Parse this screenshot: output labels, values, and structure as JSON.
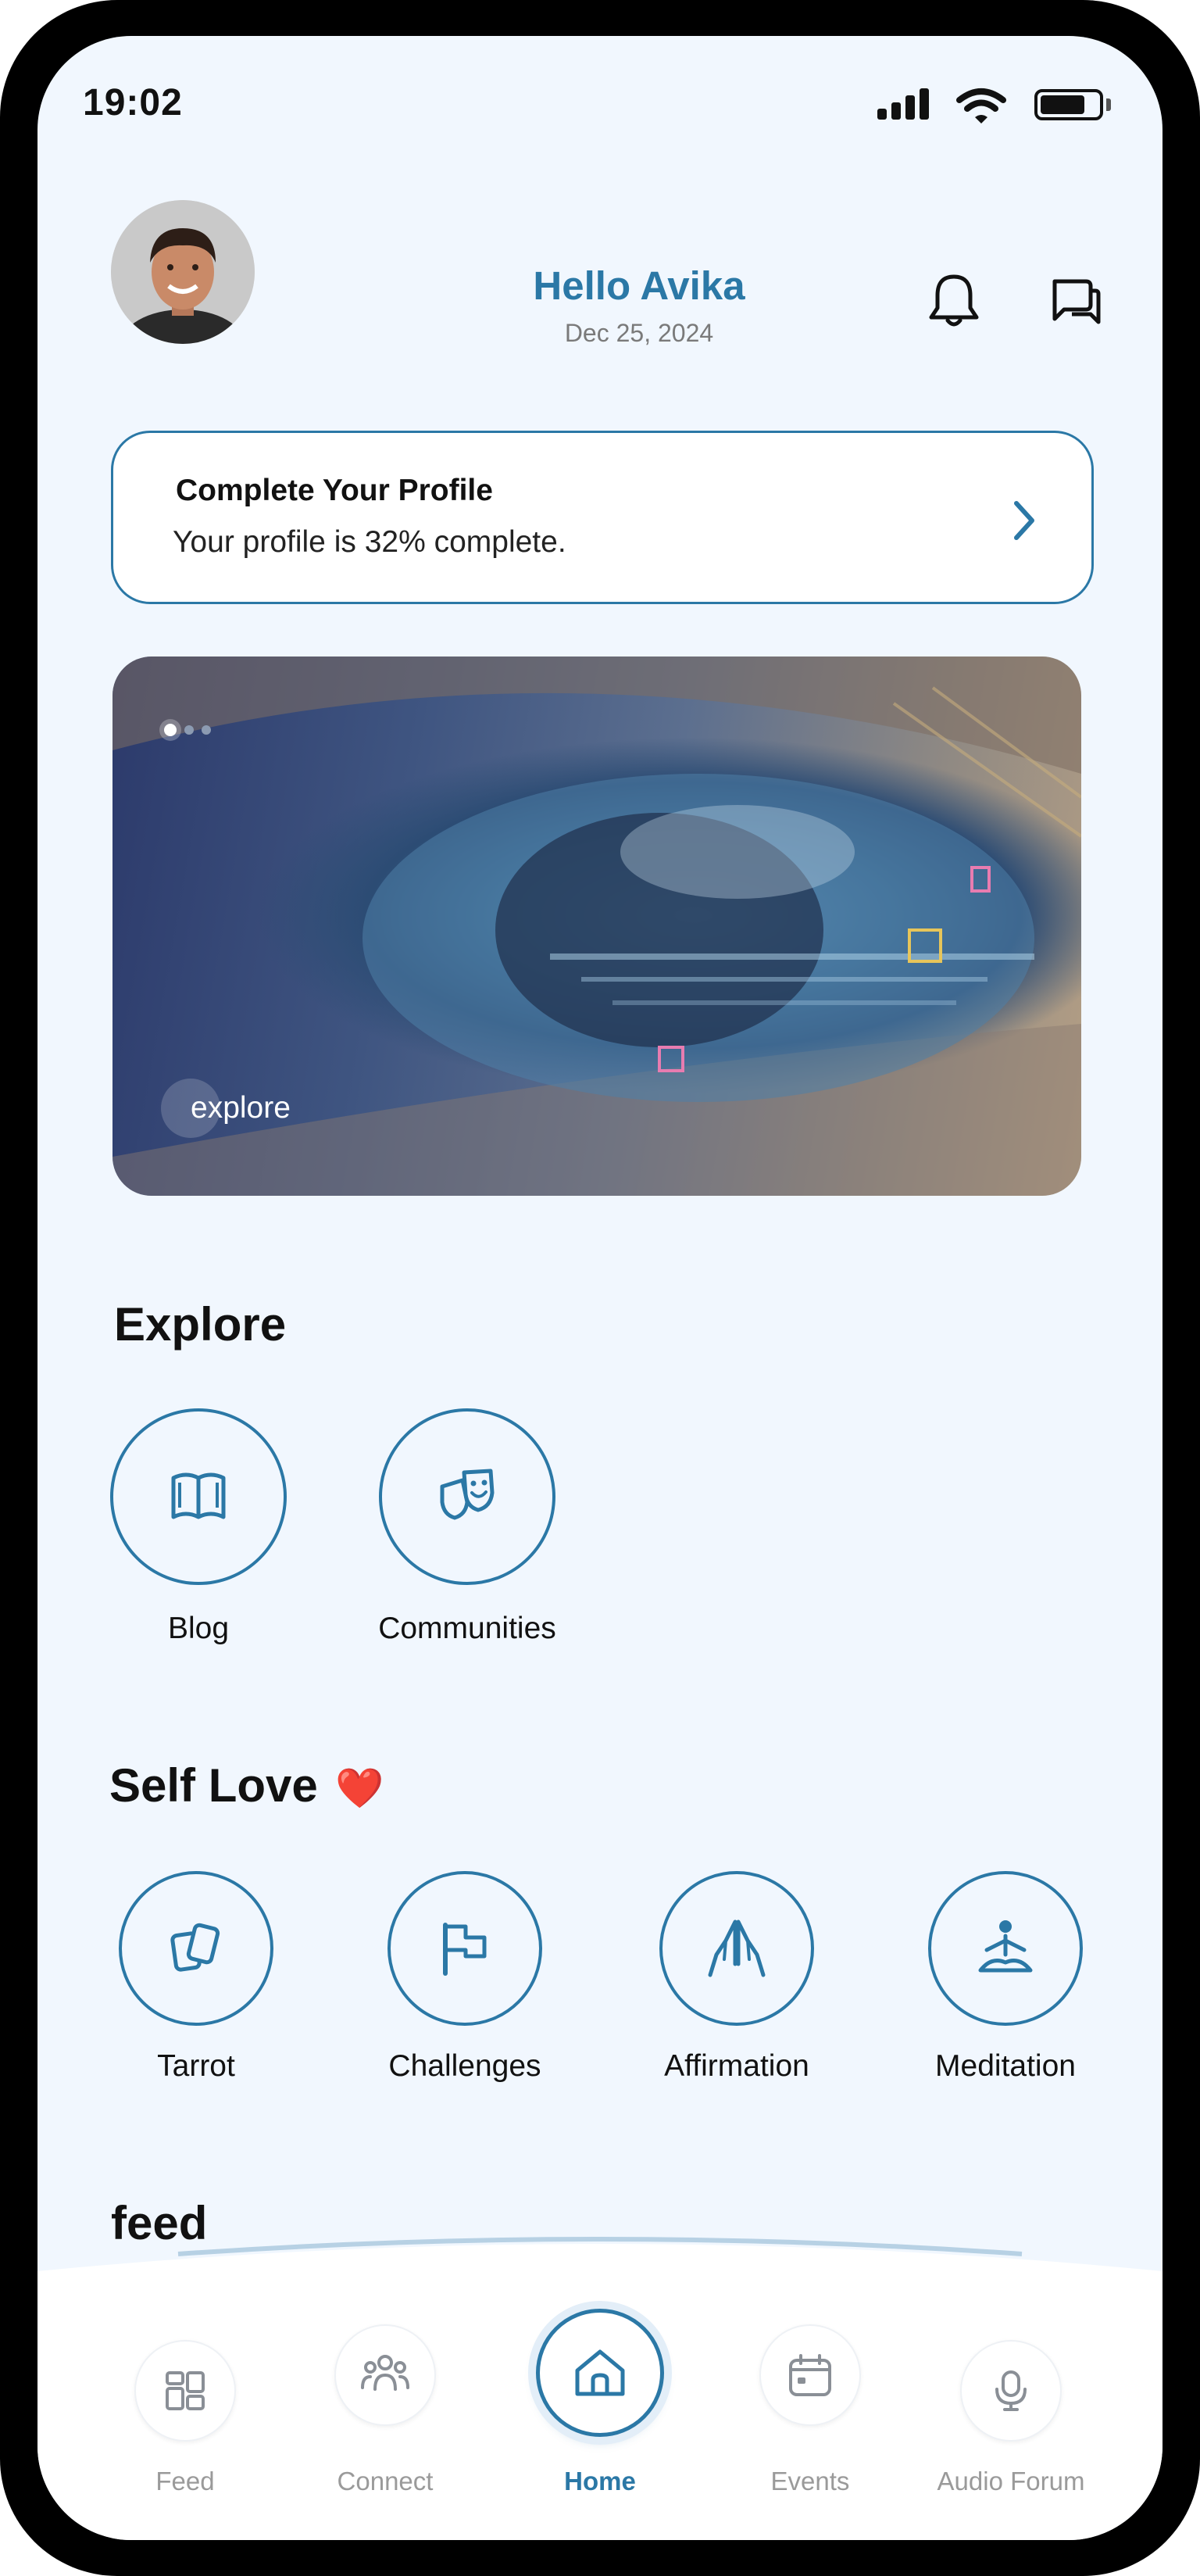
{
  "status_bar": {
    "time": "19:02"
  },
  "header": {
    "greeting": "Hello Avika",
    "date": "Dec 25, 2024"
  },
  "profile_card": {
    "title": "Complete Your Profile",
    "subtitle": "Your profile is 32% complete."
  },
  "banner": {
    "label": "explore",
    "slide_count": 3,
    "active_slide": 1
  },
  "explore": {
    "title": "Explore",
    "items": [
      {
        "label": "Blog",
        "icon": "book-icon"
      },
      {
        "label": "Communities",
        "icon": "theater-masks-icon"
      }
    ]
  },
  "self_love": {
    "title": "Self Love",
    "emoji": "❤️",
    "items": [
      {
        "label": "Tarrot",
        "icon": "cards-icon"
      },
      {
        "label": "Challenges",
        "icon": "flag-icon"
      },
      {
        "label": "Affirmation",
        "icon": "praying-hands-icon"
      },
      {
        "label": "Meditation",
        "icon": "meditation-icon"
      }
    ]
  },
  "feed": {
    "title": "feed"
  },
  "bottom_nav": {
    "active": "Home",
    "items": [
      {
        "label": "Feed",
        "icon": "grid-icon"
      },
      {
        "label": "Connect",
        "icon": "people-icon"
      },
      {
        "label": "Home",
        "icon": "home-icon"
      },
      {
        "label": "Events",
        "icon": "calendar-icon"
      },
      {
        "label": "Audio Forum",
        "icon": "microphone-icon"
      }
    ]
  },
  "colors": {
    "accent": "#2b78a6",
    "background": "#f1f7fe",
    "text": "#111111",
    "muted": "#9a9a9a"
  }
}
